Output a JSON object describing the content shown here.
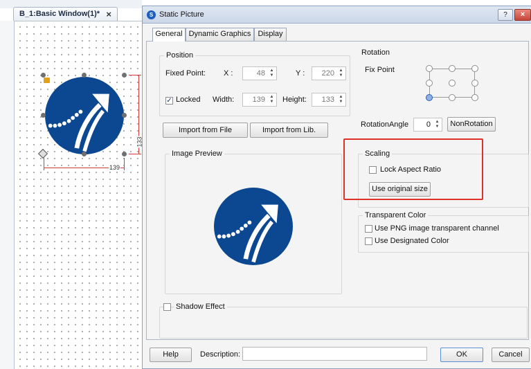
{
  "editor": {
    "tab_label": "B_1:Basic Window(1)*",
    "tab_close_icon": "×",
    "width_dimension": "139",
    "height_dimension": "133"
  },
  "dialog": {
    "title": "Static Picture",
    "title_help_label": "?",
    "title_close_label": "×",
    "tabs": [
      {
        "label": "General",
        "active": true
      },
      {
        "label": "Dynamic Graphics",
        "active": false
      },
      {
        "label": "Display",
        "active": false
      }
    ],
    "position": {
      "title": "Position",
      "fixed_point_label": "Fixed Point:",
      "x_label": "X :",
      "x_value": "48",
      "y_label": "Y :",
      "y_value": "220",
      "locked_label": "Locked",
      "locked_checked": true,
      "width_label": "Width:",
      "width_value": "139",
      "height_label": "Height:",
      "height_value": "133"
    },
    "rotation": {
      "title": "Rotation",
      "fix_point_label": "Fix Point",
      "angle_label": "RotationAngle",
      "angle_value": "0",
      "nonrotation_label": "NonRotation"
    },
    "import_file_label": "Import from File",
    "import_lib_label": "Import from Lib.",
    "image_preview": {
      "title": "Image Preview"
    },
    "scaling": {
      "title": "Scaling",
      "lock_aspect_label": "Lock Aspect Ratio",
      "lock_aspect_checked": false,
      "use_original_label": "Use original size"
    },
    "transparent": {
      "title": "Transparent Color",
      "png_channel_label": "Use PNG image transparent channel",
      "png_channel_checked": false,
      "designated_label": "Use Designated Color",
      "designated_checked": false
    },
    "shadow": {
      "label": "Shadow Effect",
      "checked": false
    },
    "footer": {
      "help_label": "Help",
      "description_label": "Description:",
      "description_value": "",
      "ok_label": "OK",
      "cancel_label": "Cancel"
    }
  },
  "colors": {
    "logo_blue": "#0c4791",
    "highlight_red": "#e0302a",
    "dimension_red": "#d63b3b"
  }
}
